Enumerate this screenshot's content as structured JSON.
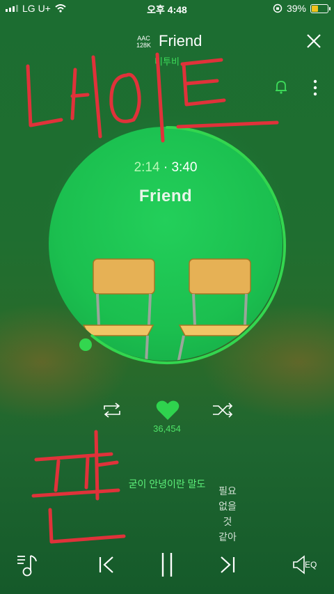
{
  "status_bar": {
    "carrier": "LG U+",
    "time": "오후 4:48",
    "battery": "39%",
    "battery_level": 0.39
  },
  "header": {
    "quality_top": "AAC",
    "quality_bottom": "128K",
    "title": "Friend",
    "artist": "비투비"
  },
  "player": {
    "current_time": "2:14",
    "separator": "·",
    "total_time": "3:40",
    "album_title": "Friend",
    "progress": 0.61
  },
  "controls": {
    "likes": "36,454"
  },
  "lyrics": {
    "current": "굳이 안녕이란 말도",
    "next": "필요 없을 것 같아"
  },
  "bottom_bar": {
    "eq_label": "EQ"
  },
  "colors": {
    "accent": "#3ddc5a",
    "disc": "#1bbf4f",
    "annotation": "#e0323a"
  },
  "annotations": {
    "top": "네이트",
    "bottom": "판"
  }
}
